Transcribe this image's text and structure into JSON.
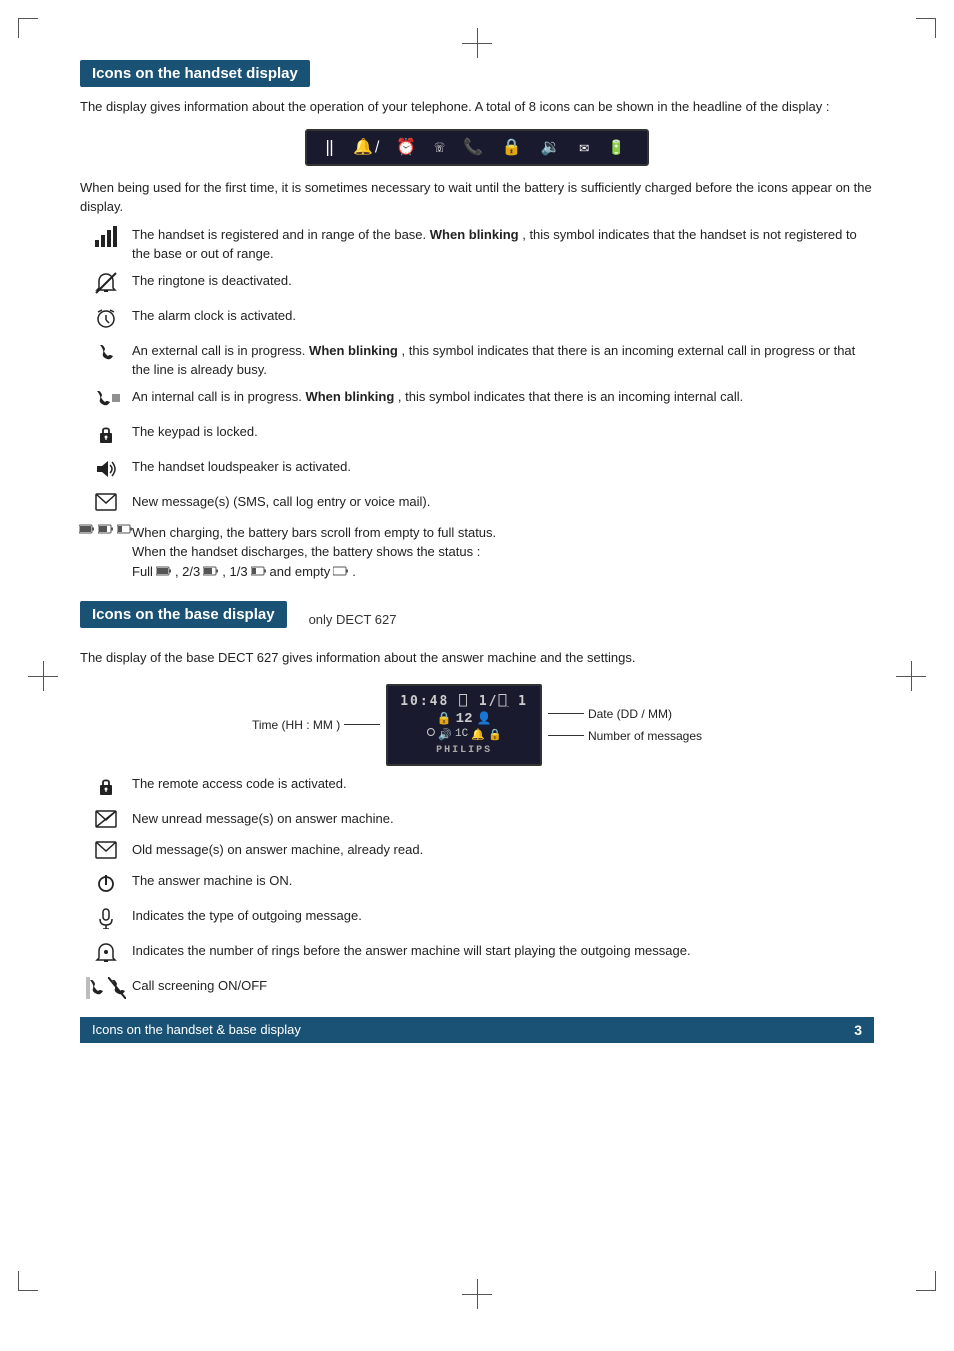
{
  "page": {
    "corners": true,
    "crosshairs": true
  },
  "handset_section": {
    "title": "Icons on the handset display",
    "intro": "The display gives information about the operation of your telephone. A total of 8 icons can be shown in the headline of the display :",
    "icon_bar_label": "handset icon bar",
    "charge_note": "When being used for the first time, it is sometimes necessary to wait until the battery is sufficiently charged before the icons appear on the display.",
    "icons": [
      {
        "symbol": "signal",
        "desc_plain": "The handset is registered and in range of the base.",
        "desc_bold": "When blinking",
        "desc_after": ", this symbol indicates that the handset is not registered to the base or out of range."
      },
      {
        "symbol": "ringtone",
        "desc_plain": "The ringtone is deactivated.",
        "desc_bold": "",
        "desc_after": ""
      },
      {
        "symbol": "alarm",
        "desc_plain": "The alarm clock is activated.",
        "desc_bold": "",
        "desc_after": ""
      },
      {
        "symbol": "external_call",
        "desc_plain": "An external call is in progress.",
        "desc_bold": "When blinking",
        "desc_after": ", this symbol indicates that there is an incoming external call in progress or that the line is already busy."
      },
      {
        "symbol": "internal_call",
        "desc_plain": "An internal call is in progress.",
        "desc_bold": "When blinking",
        "desc_after": ", this symbol indicates that there is an incoming internal call."
      },
      {
        "symbol": "keypad",
        "desc_plain": "The keypad is locked.",
        "desc_bold": "",
        "desc_after": ""
      },
      {
        "symbol": "loudspeaker",
        "desc_plain": "The handset loudspeaker is activated.",
        "desc_bold": "",
        "desc_after": ""
      },
      {
        "symbol": "message",
        "desc_plain": "New message(s) (SMS, call log entry or voice mail).",
        "desc_bold": "",
        "desc_after": ""
      }
    ],
    "battery_desc": "When charging, the battery bars scroll from empty to full status.",
    "battery_desc2": "When the handset discharges, the battery shows the status :",
    "battery_desc3": "Full",
    "battery_desc4": ", 2/3",
    "battery_desc5": ", 1/3",
    "battery_desc6": "and empty"
  },
  "base_section": {
    "title": "Icons on the base display",
    "only_dect": "only DECT 627",
    "intro": "The display of the base DECT 627 gives information about the answer machine and the settings.",
    "diagram": {
      "time_label": "Time (HH : MM )",
      "date_label": "Date (DD / MM)",
      "messages_label": "Number of messages",
      "screen_time": "10:48 0 1/0 1",
      "screen_icons": "🔒 1 2 🔒",
      "screen_row2": "⌚🔊 1C 🔔🔒",
      "screen_brand": "PHILIPS"
    },
    "icons": [
      {
        "symbol": "lock",
        "desc_plain": "The remote access code is activated.",
        "desc_bold": "",
        "desc_after": ""
      },
      {
        "symbol": "msg_new",
        "desc_plain": "New unread message(s) on answer machine.",
        "desc_bold": "",
        "desc_after": ""
      },
      {
        "symbol": "msg_old",
        "desc_plain": "Old message(s) on answer machine, already read.",
        "desc_bold": "",
        "desc_after": ""
      },
      {
        "symbol": "power",
        "desc_plain": "The answer machine is ON.",
        "desc_bold": "",
        "desc_after": ""
      },
      {
        "symbol": "mic",
        "desc_plain": "Indicates the type of outgoing message.",
        "desc_bold": "",
        "desc_after": ""
      },
      {
        "symbol": "ring_count",
        "desc_plain": "Indicates the number of rings before the answer machine will start playing the outgoing message.",
        "desc_bold": "",
        "desc_after": ""
      },
      {
        "symbol": "call_screen",
        "desc_plain": "Call screening ON/OFF",
        "desc_bold": "",
        "desc_after": "",
        "dual": true
      }
    ]
  },
  "footer": {
    "label": "Icons on the handset & base display",
    "page": "3"
  }
}
